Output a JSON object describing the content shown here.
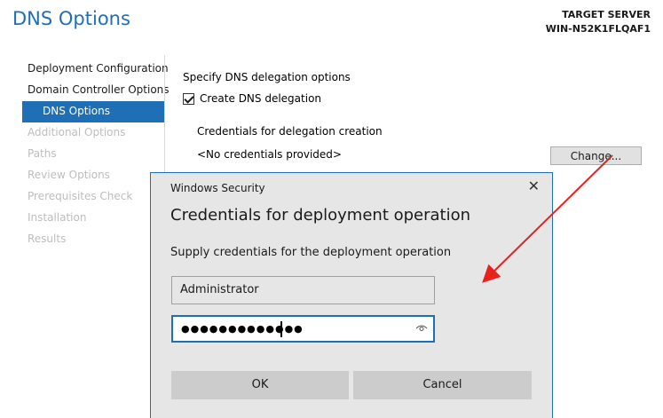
{
  "header": {
    "title": "DNS Options",
    "target_label": "TARGET SERVER",
    "target_name": "WIN-N52K1FLQAF1"
  },
  "nav": {
    "items": [
      {
        "label": "Deployment Configuration",
        "state": "normal"
      },
      {
        "label": "Domain Controller Options",
        "state": "normal"
      },
      {
        "label": "DNS Options",
        "state": "active"
      },
      {
        "label": "Additional Options",
        "state": "disabled"
      },
      {
        "label": "Paths",
        "state": "disabled"
      },
      {
        "label": "Review Options",
        "state": "disabled"
      },
      {
        "label": "Prerequisites Check",
        "state": "disabled"
      },
      {
        "label": "Installation",
        "state": "disabled"
      },
      {
        "label": "Results",
        "state": "disabled"
      }
    ]
  },
  "main": {
    "spec_label": "Specify DNS delegation options",
    "create_delegation_label": "Create DNS delegation",
    "create_delegation_checked": true,
    "credentials_label": "Credentials for delegation creation",
    "credentials_value": "<No credentials provided>",
    "change_button": "Change..."
  },
  "dialog": {
    "window_title": "Windows Security",
    "close_glyph": "✕",
    "heading": "Credentials for deployment operation",
    "prompt": "Supply credentials for the deployment operation",
    "username_value": "Administrator",
    "password_mask": "●●●●●●●●●●●●●",
    "ok_button": "OK",
    "cancel_button": "Cancel"
  },
  "colors": {
    "accent": "#1f6fb6",
    "arrow": "#e8211c"
  }
}
